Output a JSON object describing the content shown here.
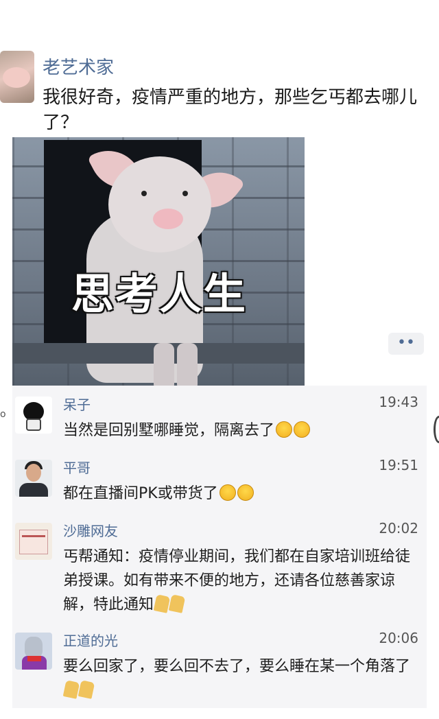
{
  "post": {
    "author": "老艺术家",
    "text": "我很好奇，疫情严重的地方，那些乞丐都去哪儿了？",
    "image_caption": "思考人生"
  },
  "more_button": {
    "label": "••"
  },
  "comments": [
    {
      "name": "呆子",
      "time": "19:43",
      "text": "当然是回别墅哪睡觉，隔离去了",
      "emoji": [
        "grin-emoji",
        "grin-emoji"
      ]
    },
    {
      "name": "平哥",
      "time": "19:51",
      "text": "都在直播间PK或带货了",
      "emoji": [
        "thinking-emoji",
        "thinking-emoji"
      ]
    },
    {
      "name": "沙雕网友",
      "time": "20:02",
      "text": "丐帮通知：疫情停业期间，我们都在自家培训班给徒弟授课。如有带来不便的地方，还请各位慈善家谅解，特此通知",
      "emoji": [
        "pray-emoji",
        "pray-emoji"
      ]
    },
    {
      "name": "正道的光",
      "time": "20:06",
      "text": "要么回家了，要么回不去了，要么睡在某一个角落了",
      "emoji": [
        "pray-emoji",
        "pray-emoji"
      ]
    }
  ],
  "colors": {
    "name_blue": "#4f6c95",
    "comment_bg": "#f5f5f7"
  }
}
